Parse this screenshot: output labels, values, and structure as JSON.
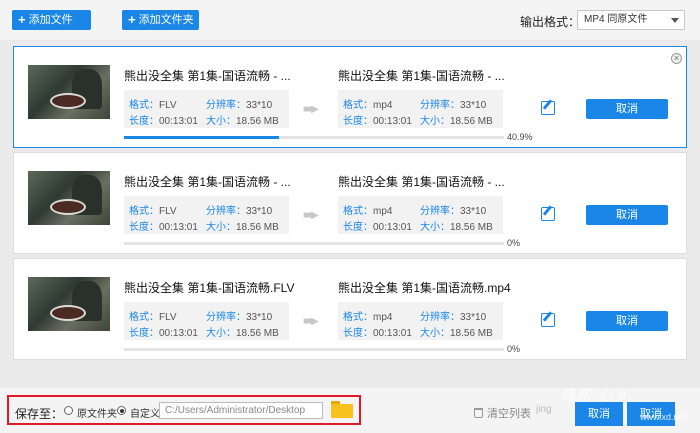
{
  "toolbar": {
    "add_file_label": "添加文件",
    "add_folder_label": "添加文件夹",
    "output_format_label": "输出格式：",
    "output_format_value": "MP4  同原文件"
  },
  "items": [
    {
      "source_name": "熊出没全集 第1集-国语流畅 - ...",
      "source_format": "FLV",
      "source_resolution": "33*10",
      "source_duration": "00:13:01",
      "source_size": "18.56 MB",
      "target_name": "熊出没全集 第1集-国语流畅 - ...",
      "target_format": "mp4",
      "target_resolution": "33*10",
      "target_duration": "00:13:01",
      "target_size": "18.56 MB",
      "progress_text": "40.9%",
      "progress": 0.409,
      "cancel_label": "取消"
    },
    {
      "source_name": "熊出没全集 第1集-国语流畅 - ...",
      "source_format": "FLV",
      "source_resolution": "33*10",
      "source_duration": "00:13:01",
      "source_size": "18.56 MB",
      "target_name": "熊出没全集 第1集-国语流畅 - ...",
      "target_format": "mp4",
      "target_resolution": "33*10",
      "target_duration": "00:13:01",
      "target_size": "18.56 MB",
      "progress_text": "0%",
      "progress": 0,
      "cancel_label": "取消"
    },
    {
      "source_name": "熊出没全集 第1集-国语流畅.FLV",
      "source_format": "FLV",
      "source_resolution": "33*10",
      "source_duration": "00:13:01",
      "source_size": "18.56 MB",
      "target_name": "熊出没全集 第1集-国语流畅.mp4",
      "target_format": "mp4",
      "target_resolution": "33*10",
      "target_duration": "00:13:01",
      "target_size": "18.56 MB",
      "progress_text": "0%",
      "progress": 0,
      "cancel_label": "取消"
    }
  ],
  "labels": {
    "format": "格式：",
    "resolution": "分辨率：",
    "duration": "长度：",
    "size": "大小："
  },
  "bottom": {
    "save_to_label": "保存至：",
    "option_original": "原文件夹",
    "option_custom": "自定义",
    "path_value": "C:/Users/Administrator/Desktop",
    "clear_list_label": "清空列表",
    "cancel_label": "取消",
    "cancel_all_label": "取消"
  },
  "watermark": {
    "text": "晓东 心 ∂",
    "sub": "www.xd.net",
    "jing": "jing"
  },
  "colors": {
    "accent": "#1a86e8",
    "highlight_box": "#e0192a"
  }
}
